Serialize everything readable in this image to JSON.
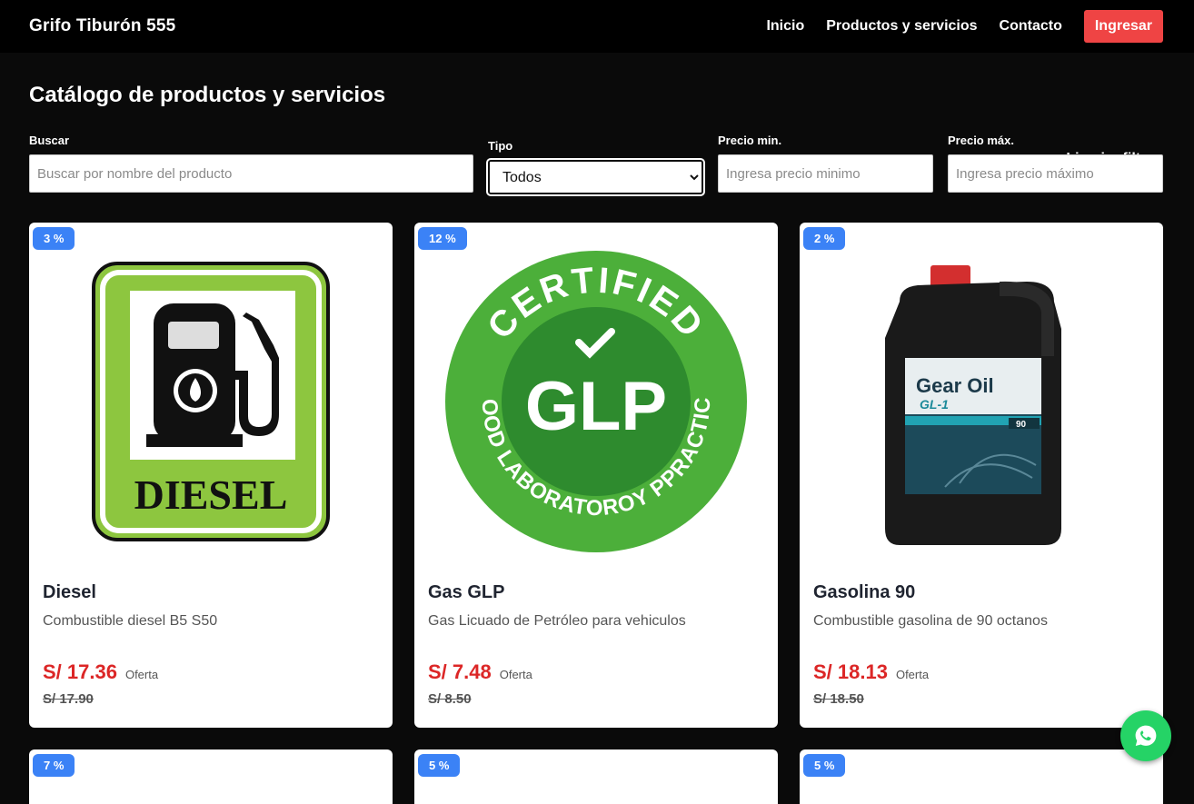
{
  "navbar": {
    "brand": "Grifo Tiburón 555",
    "links": [
      "Inicio",
      "Productos y servicios",
      "Contacto"
    ],
    "login": "Ingresar"
  },
  "main": {
    "title": "Catálogo de productos y servicios",
    "clear_filters": "Limpiar filtros"
  },
  "filters": {
    "search_label": "Buscar",
    "search_placeholder": "Buscar por nombre del producto",
    "type_label": "Tipo",
    "type_value": "Todos",
    "min_label": "Precio min.",
    "min_placeholder": "Ingresa precio minimo",
    "max_label": "Precio máx.",
    "max_placeholder": "Ingresa precio máximo"
  },
  "products": [
    {
      "badge": "3 %",
      "name": "Diesel",
      "desc": "Combustible diesel B5 S50",
      "price": "S/ 17.36",
      "offer": "Oferta",
      "old": "S/ 17.90",
      "image": "diesel-pump-icon",
      "image_text": "DIESEL"
    },
    {
      "badge": "12 %",
      "name": "Gas GLP",
      "desc": "Gas Licuado de Petróleo para vehiculos",
      "price": "S/ 7.48",
      "offer": "Oferta",
      "old": "S/ 8.50",
      "image": "glp-certified-seal",
      "image_text": "GLP"
    },
    {
      "badge": "2 %",
      "name": "Gasolina 90",
      "desc": "Combustible gasolina de 90 octanos",
      "price": "S/ 18.13",
      "offer": "Oferta",
      "old": "S/ 18.50",
      "image": "gear-oil-jug",
      "image_text": "Gear Oil GL-1"
    }
  ],
  "row2_badges": [
    "7 %",
    "5 %",
    "5 %"
  ],
  "whatsapp": {
    "icon": "whatsapp-icon"
  },
  "colors": {
    "accent": "#ef4444",
    "badge": "#3b82f6",
    "price": "#dc2626",
    "whatsapp": "#25d366"
  }
}
